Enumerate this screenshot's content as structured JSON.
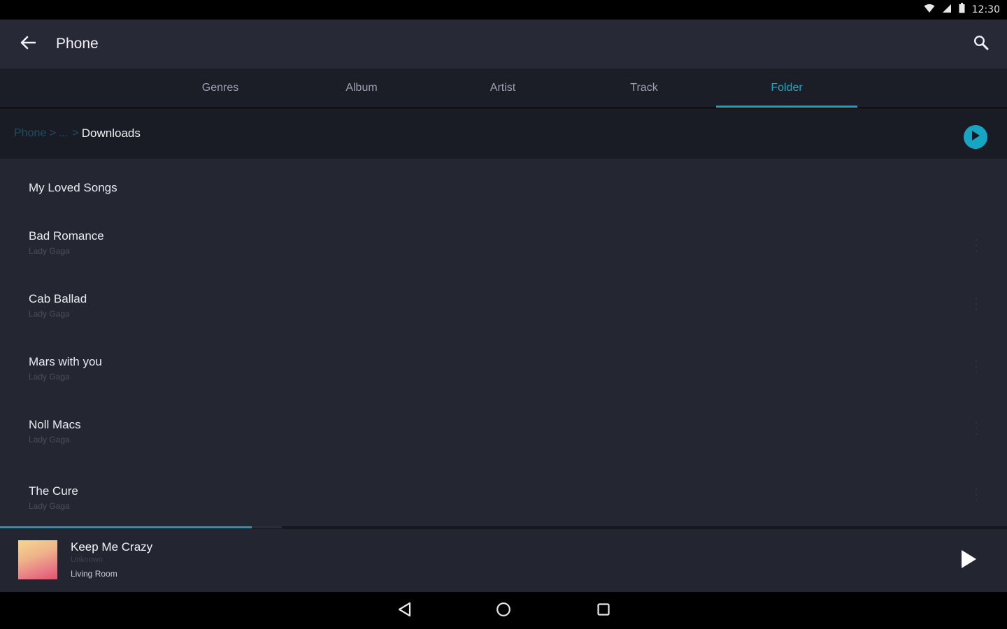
{
  "status_bar": {
    "time": "12:30",
    "icons": [
      "wifi-icon",
      "cell-signal-icon",
      "battery-icon"
    ]
  },
  "app_bar": {
    "title": "Phone",
    "back_icon": "arrow-back-icon",
    "search_icon": "search-icon"
  },
  "tabs": [
    {
      "label": "Genres",
      "active": false
    },
    {
      "label": "Album",
      "active": false
    },
    {
      "label": "Artist",
      "active": false
    },
    {
      "label": "Track",
      "active": false
    },
    {
      "label": "Folder",
      "active": true
    }
  ],
  "breadcrumb": {
    "parent": "Phone >",
    "ellipsis": "...",
    "separator": ">",
    "current": "Downloads",
    "play_icon": "play-circle-icon"
  },
  "list": {
    "items": [
      {
        "title": "My Loved Songs",
        "subtitle": ""
      },
      {
        "title": "Bad Romance",
        "subtitle": "Lady Gaga"
      },
      {
        "title": "Cab Ballad",
        "subtitle": "Lady Gaga"
      },
      {
        "title": "Mars with you",
        "subtitle": "Lady Gaga"
      },
      {
        "title": "Noll Macs",
        "subtitle": "Lady Gaga"
      },
      {
        "title": "The Cure",
        "subtitle": "Lady Gaga"
      }
    ]
  },
  "now_playing": {
    "title": "Keep Me Crazy",
    "artist": "Unknown",
    "device": "Living Room",
    "progress": 0.25,
    "buffered": 0.28,
    "play_icon": "play-icon"
  },
  "nav_bar": {
    "icons": [
      "back-triangle-icon",
      "home-circle-icon",
      "recents-square-icon"
    ]
  },
  "colors": {
    "accent": "#1aa1be",
    "app_bar": "#272a36",
    "list_bg": "#242732"
  }
}
